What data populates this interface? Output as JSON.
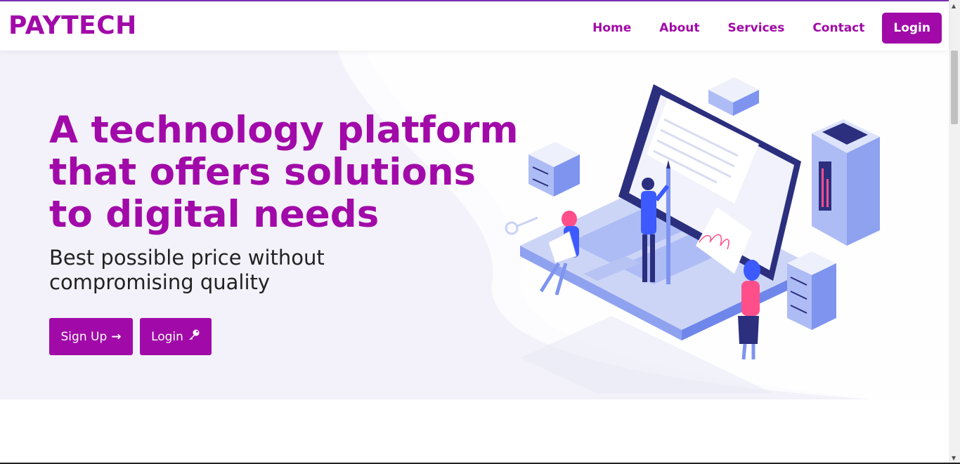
{
  "brand": "PAYTECH",
  "nav": {
    "links": [
      "Home",
      "About",
      "Services",
      "Contact"
    ],
    "login_label": "Login"
  },
  "hero": {
    "headline": "A technology platform that offers solutions to digital needs",
    "subheadline": "Best possible price without compromising quality",
    "signup_label": "Sign Up",
    "signup_icon": "arrow-right-icon",
    "login_label": "Login",
    "login_icon": "key-icon"
  },
  "colors": {
    "accent": "#a10aa8",
    "hero_bg": "#f3f2fa",
    "illustration_blue": "#3d5afe",
    "illustration_pink": "#ff4f8b"
  }
}
